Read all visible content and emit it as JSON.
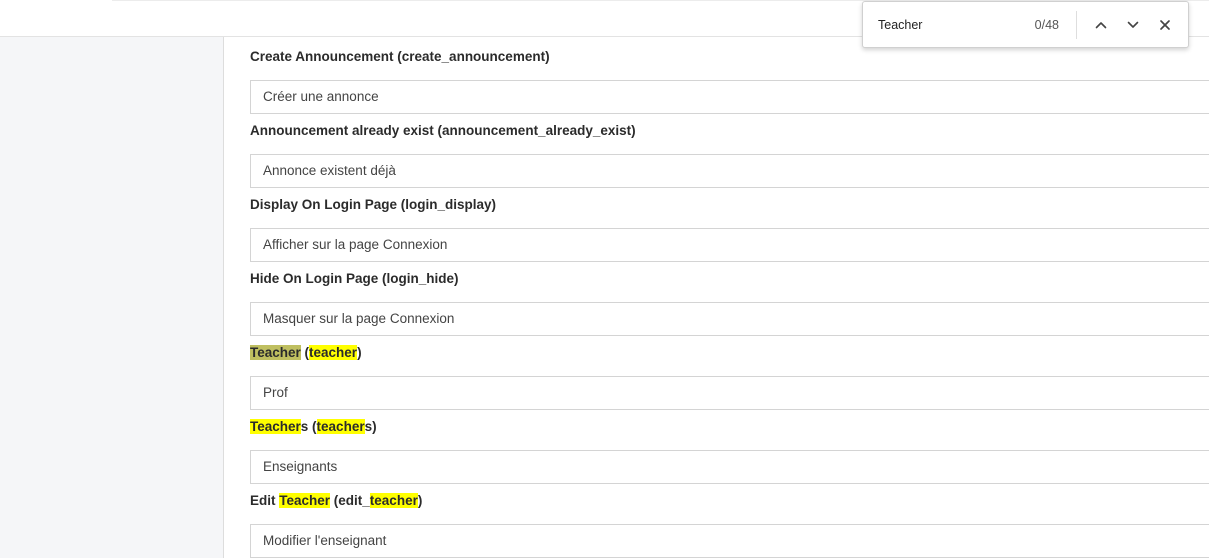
{
  "find_bar": {
    "query": "Teacher",
    "match_count": "0/48",
    "icons": [
      "chevron-up-icon",
      "chevron-down-icon",
      "close-icon"
    ]
  },
  "fields": [
    {
      "label_parts": [
        {
          "text": "Create Announcement (create_announcement)",
          "hl": ""
        }
      ],
      "value": "Créer une annonce"
    },
    {
      "label_parts": [
        {
          "text": "Announcement already exist (announcement_already_exist)",
          "hl": ""
        }
      ],
      "value": "Annonce existent déjà"
    },
    {
      "label_parts": [
        {
          "text": "Display On Login Page (login_display)",
          "hl": ""
        }
      ],
      "value": "Afficher sur la page Connexion"
    },
    {
      "label_parts": [
        {
          "text": "Hide On Login Page (login_hide)",
          "hl": ""
        }
      ],
      "value": "Masquer sur la page Connexion"
    },
    {
      "label_parts": [
        {
          "text": "Teacher",
          "hl": "active"
        },
        {
          "text": " (",
          "hl": ""
        },
        {
          "text": "teacher",
          "hl": "match"
        },
        {
          "text": ")",
          "hl": ""
        }
      ],
      "value": "Prof"
    },
    {
      "label_parts": [
        {
          "text": "Teacher",
          "hl": "match"
        },
        {
          "text": "s (",
          "hl": ""
        },
        {
          "text": "teacher",
          "hl": "match"
        },
        {
          "text": "s)",
          "hl": ""
        }
      ],
      "value": "Enseignants"
    },
    {
      "label_parts": [
        {
          "text": "Edit ",
          "hl": ""
        },
        {
          "text": "Teacher",
          "hl": "match"
        },
        {
          "text": " (edit_",
          "hl": ""
        },
        {
          "text": "teacher",
          "hl": "match"
        },
        {
          "text": ")",
          "hl": ""
        }
      ],
      "value": "Modifier l'enseignant"
    }
  ],
  "colors": {
    "match_highlight": "#ffff00",
    "active_match_highlight": "#bfbf60",
    "sidebar_bg": "#f5f6f8"
  }
}
